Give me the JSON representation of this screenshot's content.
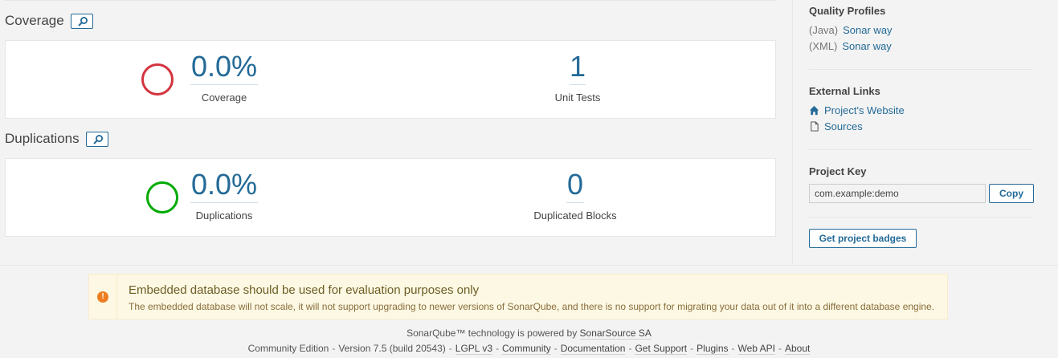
{
  "coverage": {
    "title": "Coverage",
    "drilldown_icon": "search-icon",
    "percent": "0.0%",
    "percent_label": "Coverage",
    "ring_color": "#d4333f",
    "tests": "1",
    "tests_label": "Unit Tests"
  },
  "duplications": {
    "title": "Duplications",
    "drilldown_icon": "search-icon",
    "percent": "0.0%",
    "percent_label": "Duplications",
    "ring_color": "#00aa00",
    "blocks": "0",
    "blocks_label": "Duplicated Blocks"
  },
  "sidebar": {
    "quality_profiles": {
      "heading": "Quality Profiles",
      "items": [
        {
          "lang": "(Java)",
          "name": "Sonar way"
        },
        {
          "lang": "(XML)",
          "name": "Sonar way"
        }
      ]
    },
    "external_links": {
      "heading": "External Links",
      "items": [
        {
          "icon": "home-icon",
          "label": "Project's Website"
        },
        {
          "icon": "file-icon",
          "label": "Sources"
        }
      ]
    },
    "project_key": {
      "heading": "Project Key",
      "value": "com.example:demo",
      "copy_label": "Copy"
    },
    "badges_button": "Get project badges"
  },
  "alert": {
    "icon": "warning-icon",
    "title": "Embedded database should be used for evaluation purposes only",
    "body": "The embedded database will not scale, it will not support upgrading to newer versions of SonarQube, and there is no support for migrating your data out of it into a different database engine."
  },
  "footer": {
    "powered_prefix": "SonarQube™ technology is powered by",
    "powered_link": "SonarSource SA",
    "edition": "Community Edition",
    "version": "Version 7.5 (build 20543)",
    "links": [
      "LGPL v3",
      "Community",
      "Documentation",
      "Get Support",
      "Plugins",
      "Web API",
      "About"
    ]
  },
  "colors": {
    "link": "#236a97",
    "coverage_ring": "#d4333f",
    "duplications_ring": "#00aa00",
    "alert_bg": "#fcf8e3"
  }
}
